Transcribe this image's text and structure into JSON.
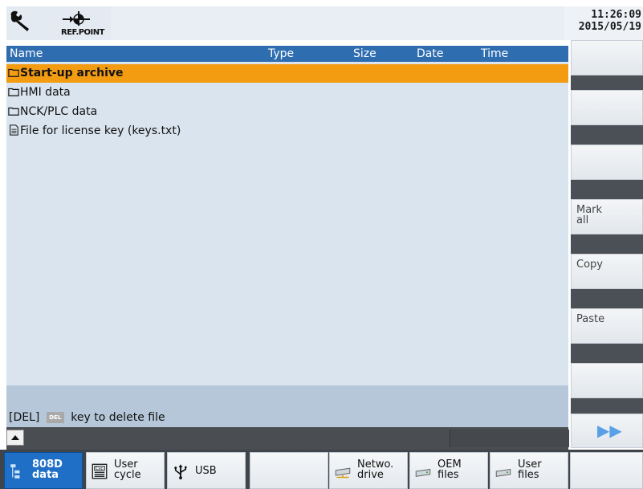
{
  "header": {
    "refpoint_label": "REF.POINT",
    "time": "11:26:09",
    "date": "2015/05/19"
  },
  "list": {
    "columns": [
      "Name",
      "Type",
      "Size",
      "Date",
      "Time"
    ],
    "rows": [
      {
        "label": "Start-up archive",
        "icon": "folder-icon",
        "selected": true
      },
      {
        "label": "HMI data",
        "icon": "folder-icon",
        "selected": false
      },
      {
        "label": "NCK/PLC data",
        "icon": "folder-icon",
        "selected": false
      },
      {
        "label": "File for license key  (keys.txt)",
        "icon": "file-icon",
        "selected": false
      }
    ]
  },
  "status": {
    "prefix": "[DEL]",
    "key": "DEL",
    "suffix": "key to delete file"
  },
  "vertical_softkeys": [
    "",
    "",
    "",
    "Mark\nall",
    "Copy",
    "Paste",
    "",
    "▶▶"
  ],
  "horizontal_softkeys": [
    {
      "label": "808D\ndata",
      "icon": "tree-icon",
      "active": true
    },
    {
      "label": "User\ncycle",
      "icon": "cycle-icon",
      "active": false
    },
    {
      "label": "USB",
      "icon": "usb-icon",
      "active": false
    },
    {
      "label": "",
      "icon": "",
      "active": false
    },
    {
      "label": "Netwo.\ndrive",
      "icon": "network-drive-icon",
      "active": false
    },
    {
      "label": "OEM\nfiles",
      "icon": "drive-icon",
      "active": false
    },
    {
      "label": "User\nfiles",
      "icon": "drive-icon",
      "active": false
    },
    {
      "label": "",
      "icon": "",
      "active": false
    }
  ],
  "colors": {
    "header_bg": "#2f6db1",
    "selection": "#f39c12",
    "active_softkey": "#1f6fc6"
  }
}
